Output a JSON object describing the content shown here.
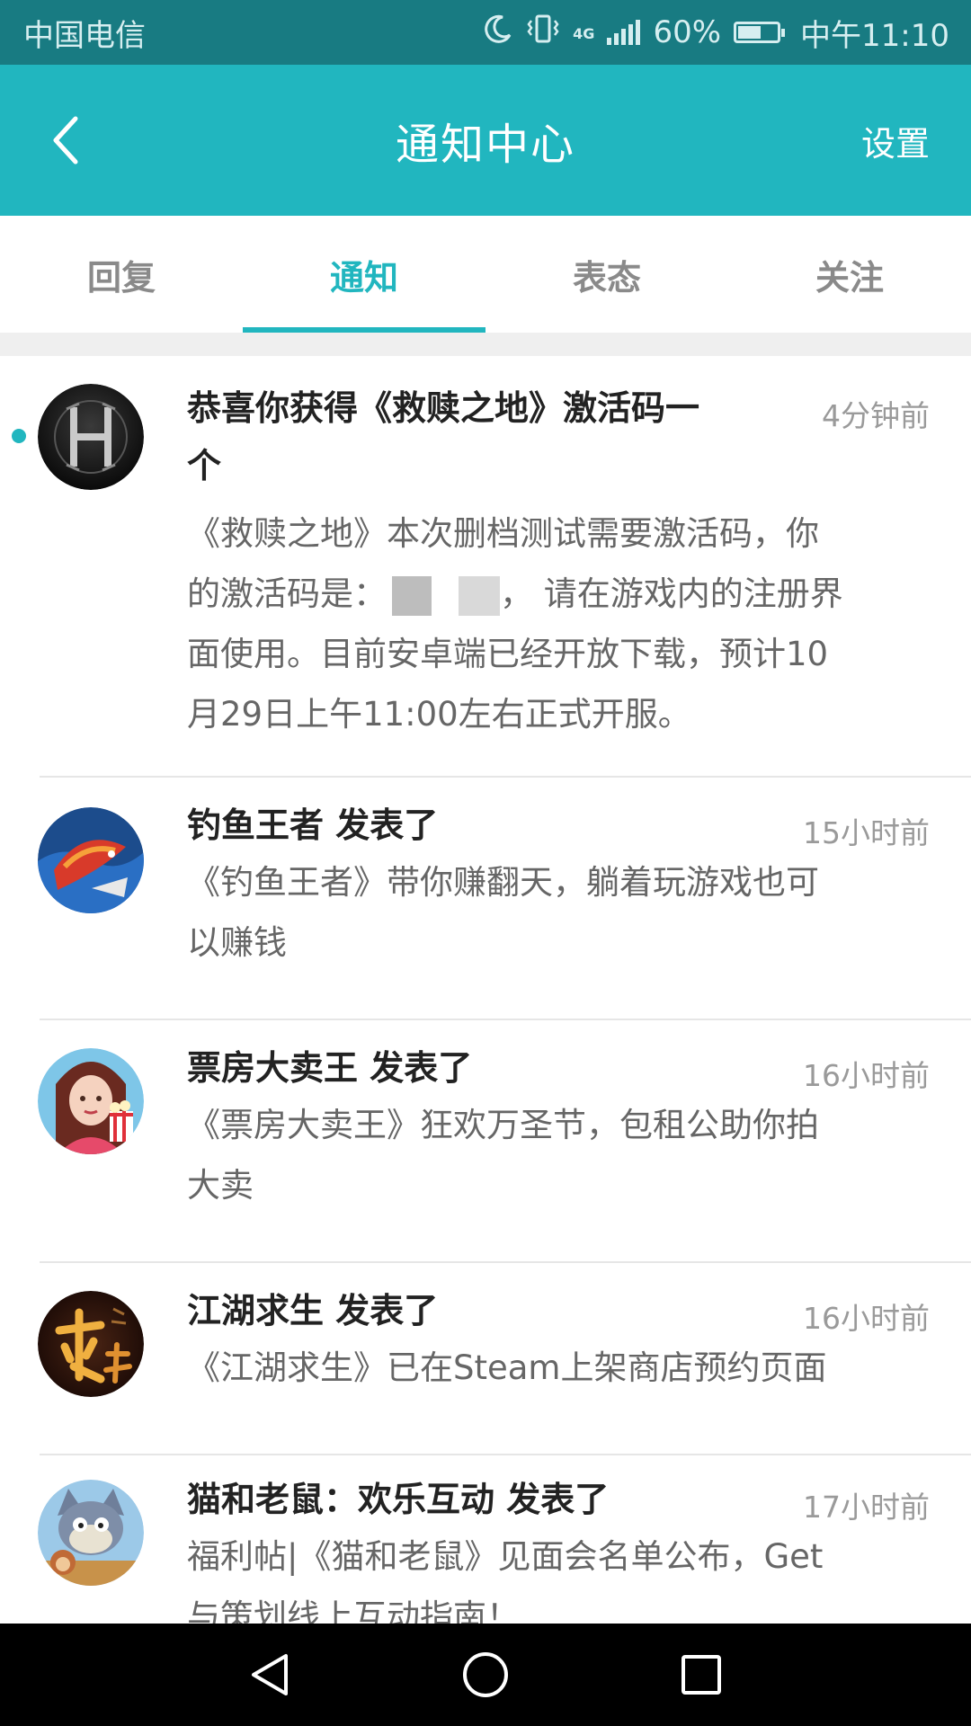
{
  "status_bar": {
    "carrier": "中国电信",
    "network": "4G",
    "battery": "60%",
    "battery_level": 0.6,
    "time": "中午11:10"
  },
  "header": {
    "title": "通知中心",
    "settings_label": "设置"
  },
  "tabs": [
    {
      "label": "回复",
      "active": false
    },
    {
      "label": "通知",
      "active": true
    },
    {
      "label": "表态",
      "active": false
    },
    {
      "label": "关注",
      "active": false
    }
  ],
  "notifications": [
    {
      "title_line1": "恭喜你获得《救赎之地》激活码一",
      "title_line2": "个",
      "time": "4分钟前",
      "body_line1": "《救赎之地》本次删档测试需要激活码，你",
      "body_line2a": "的激活码是：",
      "body_line2b": "，  请在游戏内的注册界",
      "body_line3": "面使用。目前安卓端已经开放下载，预计10",
      "body_line4": "月29日上午11:00左右正式开服。",
      "unread": true,
      "avatar": "h-logo-avatar"
    },
    {
      "title": "钓鱼王者 发表了",
      "time": "15小时前",
      "body_line1": "《钓鱼王者》带你赚翻天，躺着玩游戏也可",
      "body_line2": "以赚钱",
      "avatar": "fishing-game-avatar"
    },
    {
      "title": "票房大卖王 发表了",
      "time": "16小时前",
      "body_line1": "《票房大卖王》狂欢万圣节，包租公助你拍",
      "body_line2": "大卖",
      "avatar": "popcorn-girl-avatar"
    },
    {
      "title": "江湖求生 发表了",
      "time": "16小时前",
      "body_line1": "《江湖求生》已在Steam上架商店预约页面",
      "avatar": "jianghu-calligraphy-avatar"
    },
    {
      "title": "猫和老鼠：欢乐互动 发表了",
      "time": "17小时前",
      "body_line1": "福利帖|《猫和老鼠》见面会名单公布，Get",
      "body_line2": "与策划线上互动指南！",
      "avatar": "tom-jerry-avatar"
    }
  ],
  "colors": {
    "accent": "#21b6bf",
    "status_bar": "#187b82"
  }
}
